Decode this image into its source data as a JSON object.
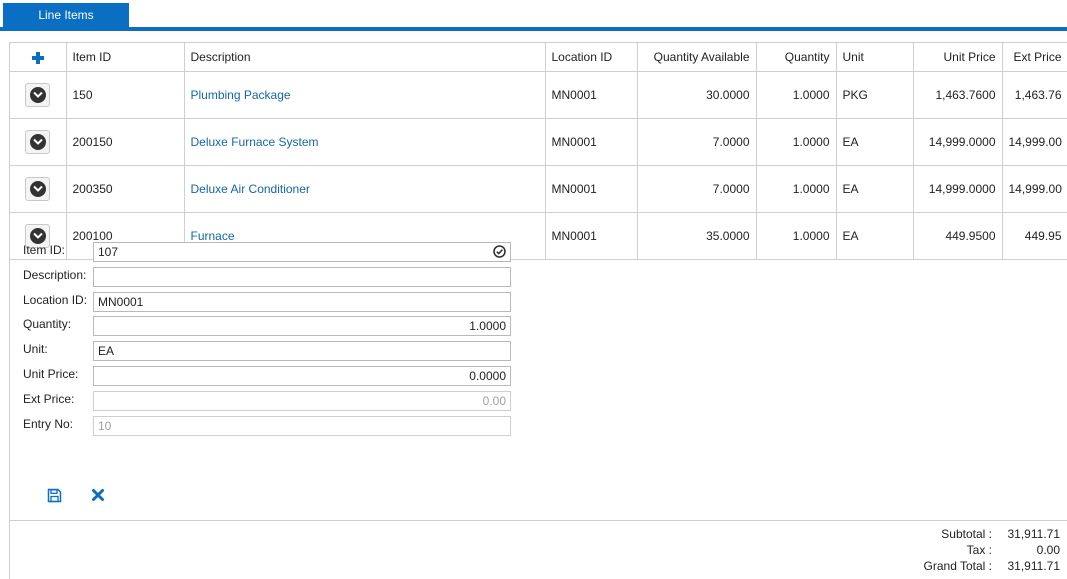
{
  "tabs": [
    {
      "label": "Line Items"
    }
  ],
  "grid": {
    "columns": [
      "Item ID",
      "Description",
      "Location ID",
      "Quantity Available",
      "Quantity",
      "Unit",
      "Unit Price",
      "Ext Price"
    ],
    "rows": [
      {
        "item_id": "150",
        "description": "Plumbing Package",
        "location_id": "MN0001",
        "qty_available": "30.0000",
        "quantity": "1.0000",
        "unit": "PKG",
        "unit_price": "1,463.7600",
        "ext_price": "1,463.76"
      },
      {
        "item_id": "200150",
        "description": "Deluxe Furnace System",
        "location_id": "MN0001",
        "qty_available": "7.0000",
        "quantity": "1.0000",
        "unit": "EA",
        "unit_price": "14,999.0000",
        "ext_price": "14,999.00"
      },
      {
        "item_id": "200350",
        "description": "Deluxe Air Conditioner",
        "location_id": "MN0001",
        "qty_available": "7.0000",
        "quantity": "1.0000",
        "unit": "EA",
        "unit_price": "14,999.0000",
        "ext_price": "14,999.00"
      },
      {
        "item_id": "200100",
        "description": "Furnace",
        "location_id": "MN0001",
        "qty_available": "35.0000",
        "quantity": "1.0000",
        "unit": "EA",
        "unit_price": "449.9500",
        "ext_price": "449.95"
      }
    ]
  },
  "form": {
    "item_id": {
      "label": "Item ID:",
      "value": "107"
    },
    "description": {
      "label": "Description:",
      "value": ""
    },
    "location_id": {
      "label": "Location ID:",
      "value": "MN0001"
    },
    "quantity": {
      "label": "Quantity:",
      "value": "1.0000"
    },
    "unit": {
      "label": "Unit:",
      "value": "EA"
    },
    "unit_price": {
      "label": "Unit Price:",
      "value": "0.0000"
    },
    "ext_price": {
      "label": "Ext Price:",
      "value": "0.00"
    },
    "entry_no": {
      "label": "Entry No:",
      "value": "10"
    }
  },
  "totals": {
    "subtotal": {
      "label": "Subtotal :",
      "value": "31,911.71"
    },
    "tax": {
      "label": "Tax :",
      "value": "0.00"
    },
    "grand_total": {
      "label": "Grand Total :",
      "value": "31,911.71"
    }
  },
  "icons": {
    "add": "plus-icon",
    "expand": "chevron-down-circle-icon",
    "lookup": "check-circle-icon",
    "save": "save-icon",
    "cancel": "close-icon"
  },
  "colors": {
    "accent": "#0a6fc2",
    "link": "#1566a8",
    "border": "#cfcfcf"
  }
}
